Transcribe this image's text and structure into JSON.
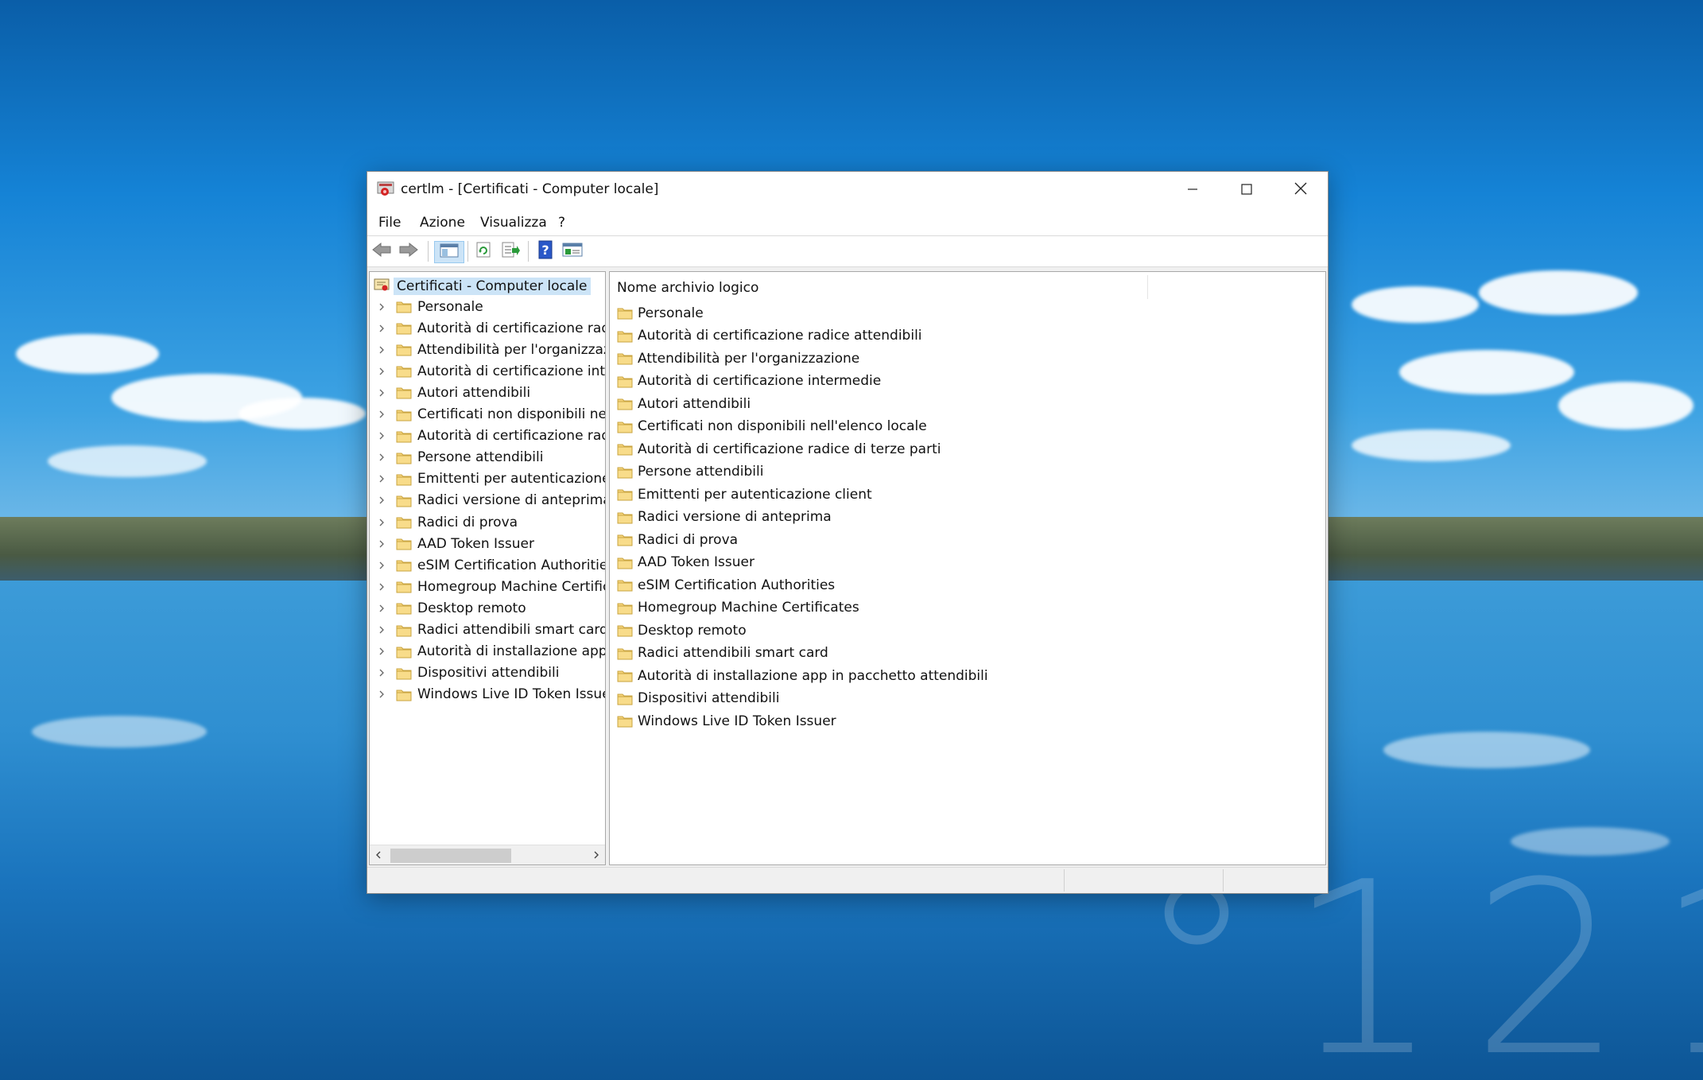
{
  "window": {
    "title": "certlm - [Certificati - Computer locale]"
  },
  "menu": [
    "File",
    "Azione",
    "Visualizza",
    "?"
  ],
  "toolbar": {
    "icons": [
      "back-arrow-icon",
      "forward-arrow-icon",
      "show-hide-tree-icon",
      "refresh-icon",
      "export-list-icon",
      "help-icon",
      "properties-icon"
    ]
  },
  "tree": {
    "root_label": "Certificati - Computer locale",
    "items": [
      "Personale",
      "Autorità di certificazione radic",
      "Attendibilità per l'organizzazi",
      "Autorità di certificazione inter",
      "Autori attendibili",
      "Certificati non disponibili nell",
      "Autorità di certificazione radic",
      "Persone attendibili",
      "Emittenti per autenticazione c",
      "Radici versione di anteprima",
      "Radici di prova",
      "AAD Token Issuer",
      "eSIM Certification Authorities",
      "Homegroup Machine Certifica",
      "Desktop remoto",
      "Radici attendibili smart card",
      "Autorità di installazione app i",
      "Dispositivi attendibili",
      "Windows Live ID Token Issuer"
    ]
  },
  "list": {
    "column_header": "Nome archivio logico",
    "items": [
      "Personale",
      "Autorità di certificazione radice attendibili",
      "Attendibilità per l'organizzazione",
      "Autorità di certificazione intermedie",
      "Autori attendibili",
      "Certificati non disponibili nell'elenco locale",
      "Autorità di certificazione radice di terze parti",
      "Persone attendibili",
      "Emittenti per autenticazione client",
      "Radici versione di anteprima",
      "Radici di prova",
      "AAD Token Issuer",
      "eSIM Certification Authorities",
      "Homegroup Machine Certificates",
      "Desktop remoto",
      "Radici attendibili smart card",
      "Autorità di installazione app in pacchetto attendibili",
      "Dispositivi attendibili",
      "Windows Live ID Token Issuer"
    ]
  },
  "colors": {
    "selection": "#cce4f7",
    "folder": "#f5d37a"
  }
}
